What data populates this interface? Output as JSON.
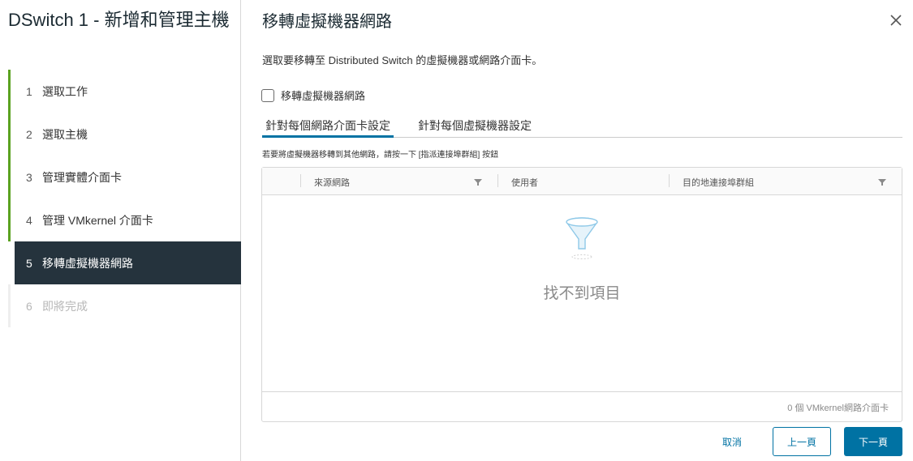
{
  "sidebar": {
    "title": "DSwitch 1 - 新增和管理主機",
    "steps": [
      {
        "num": "1",
        "label": "選取工作"
      },
      {
        "num": "2",
        "label": "選取主機"
      },
      {
        "num": "3",
        "label": "管理實體介面卡"
      },
      {
        "num": "4",
        "label": "管理 VMkernel 介面卡"
      },
      {
        "num": "5",
        "label": "移轉虛擬機器網路"
      },
      {
        "num": "6",
        "label": "即將完成"
      }
    ]
  },
  "main": {
    "title": "移轉虛擬機器網路",
    "description": "選取要移轉至 Distributed Switch 的虛擬機器或網路介面卡。",
    "checkbox_label": "移轉虛擬機器網路",
    "tabs": [
      {
        "label": "針對每個網路介面卡設定"
      },
      {
        "label": "針對每個虛擬機器設定"
      }
    ],
    "hint": "若要將虛擬機器移轉到其他網路，請按一下 [指派連接埠群組] 按鈕",
    "grid": {
      "columns": [
        "來源網路",
        "使用者",
        "目的地連接埠群組"
      ],
      "empty_text": "找不到項目",
      "footer": "0 個 VMkernel網路介面卡"
    }
  },
  "buttons": {
    "cancel": "取消",
    "back": "上一頁",
    "next": "下一頁"
  },
  "colors": {
    "accent": "#0072a3",
    "active_step_bg": "#25333d",
    "done_step_bar": "#5aa220"
  }
}
